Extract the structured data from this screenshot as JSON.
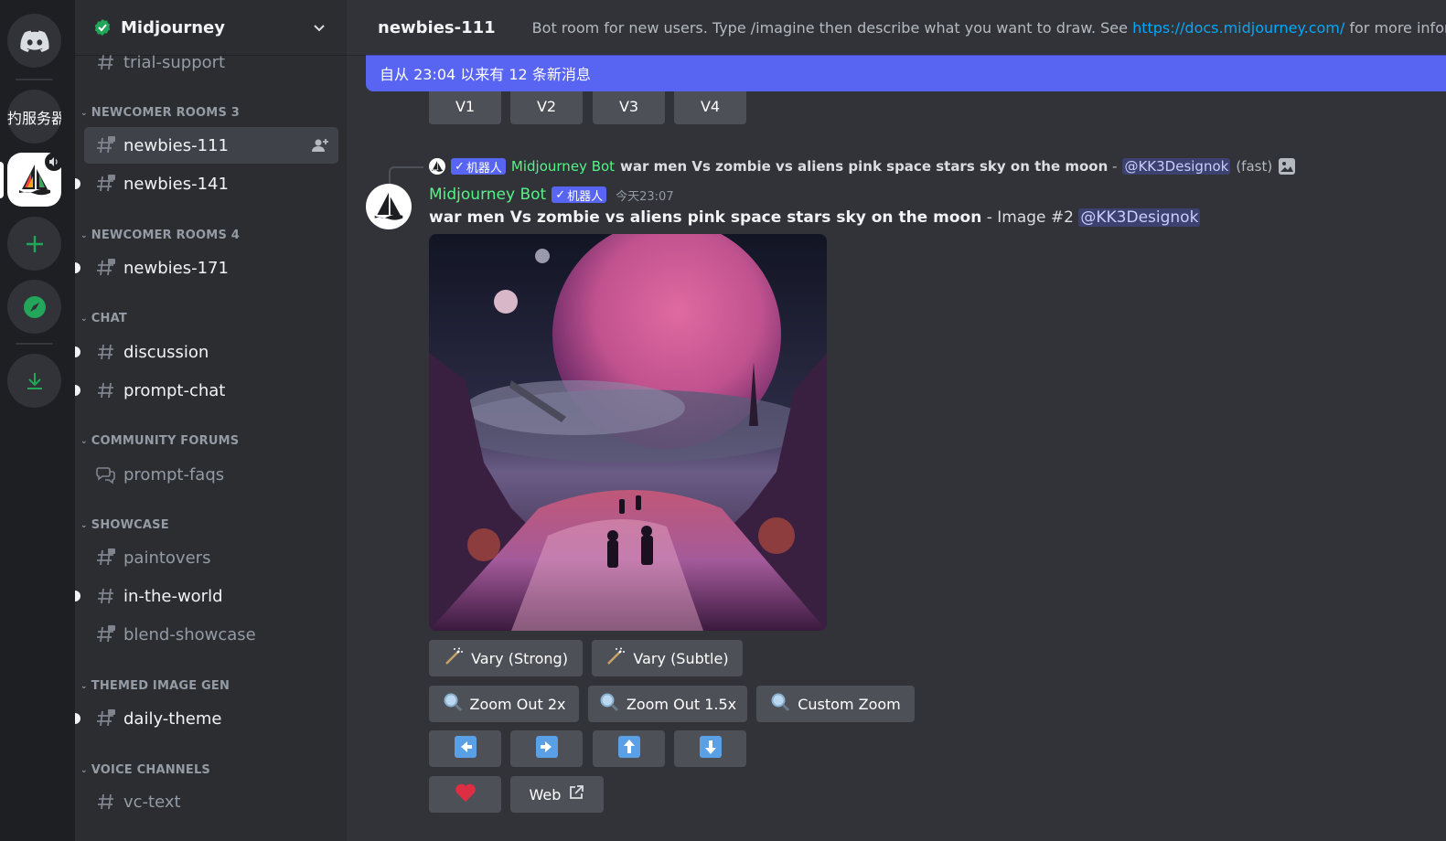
{
  "server_rail": {
    "items": [
      {
        "name": "discord-home",
        "label": ""
      },
      {
        "name": "server-text",
        "label": "扚服务器"
      },
      {
        "name": "midjourney-server",
        "label": ""
      },
      {
        "name": "add-server",
        "label": ""
      },
      {
        "name": "explore",
        "label": ""
      },
      {
        "name": "download-apps",
        "label": ""
      }
    ]
  },
  "sidebar": {
    "guild_name": "Midjourney",
    "partial_channel": "trial-support",
    "categories": [
      {
        "label": "NEWCOMER ROOMS 3"
      },
      {
        "label": "NEWCOMER ROOMS 4"
      },
      {
        "label": "CHAT"
      },
      {
        "label": "COMMUNITY FORUMS"
      },
      {
        "label": "SHOWCASE"
      },
      {
        "label": "THEMED IMAGE GEN"
      },
      {
        "label": "VOICE CHANNELS"
      }
    ],
    "channels": [
      {
        "label": "newbies-111",
        "state": "active"
      },
      {
        "label": "newbies-141",
        "state": "unread"
      },
      {
        "label": "newbies-171",
        "state": "unread"
      },
      {
        "label": "discussion",
        "state": "unread"
      },
      {
        "label": "prompt-chat",
        "state": "unread"
      },
      {
        "label": "prompt-faqs",
        "state": "read"
      },
      {
        "label": "paintovers",
        "state": "read"
      },
      {
        "label": "in-the-world",
        "state": "unread"
      },
      {
        "label": "blend-showcase",
        "state": "read"
      },
      {
        "label": "daily-theme",
        "state": "unread"
      },
      {
        "label": "vc-text",
        "state": "read"
      }
    ]
  },
  "header": {
    "channel_name": "newbies-111",
    "topic_prefix": "Bot room for new users. Type /imagine then describe what you want to draw. See ",
    "topic_link": "https://docs.midjourney.com/",
    "topic_suffix": " for more information"
  },
  "banner": {
    "text": "自从 23:04 以来有 12 条新消息"
  },
  "prev_buttons": [
    "V1",
    "V2",
    "V3",
    "V4"
  ],
  "message": {
    "reply": {
      "bot_tag": "机器人",
      "author": "Midjourney Bot",
      "prompt": "war men Vs zombie vs aliens pink space stars sky on the moon",
      "dash": " - ",
      "mention": "@KK3Designok",
      "speed": "(fast)"
    },
    "author": "Midjourney Bot",
    "bot_tag": "机器人",
    "timestamp": "今天23:07",
    "prompt": "war men Vs zombie vs aliens pink space stars sky on the moon",
    "suffix": " - Image #2 ",
    "mention": "@KK3Designok"
  },
  "actions": {
    "vary_strong": "Vary (Strong)",
    "vary_subtle": "Vary (Subtle)",
    "zoom_out_2x": "Zoom Out 2x",
    "zoom_out_15x": "Zoom Out 1.5x",
    "custom_zoom": "Custom Zoom",
    "pan_left": "arrow-left-icon",
    "pan_right": "arrow-right-icon",
    "pan_up": "arrow-up-icon",
    "pan_down": "arrow-down-icon",
    "favorite": "heart-icon",
    "web": "Web"
  },
  "colors": {
    "accent": "#5865f2",
    "bot_name": "#57f287",
    "link": "#00a8fc",
    "background": "#313338",
    "sidebar": "#2b2d31",
    "rail": "#1e1f22"
  }
}
